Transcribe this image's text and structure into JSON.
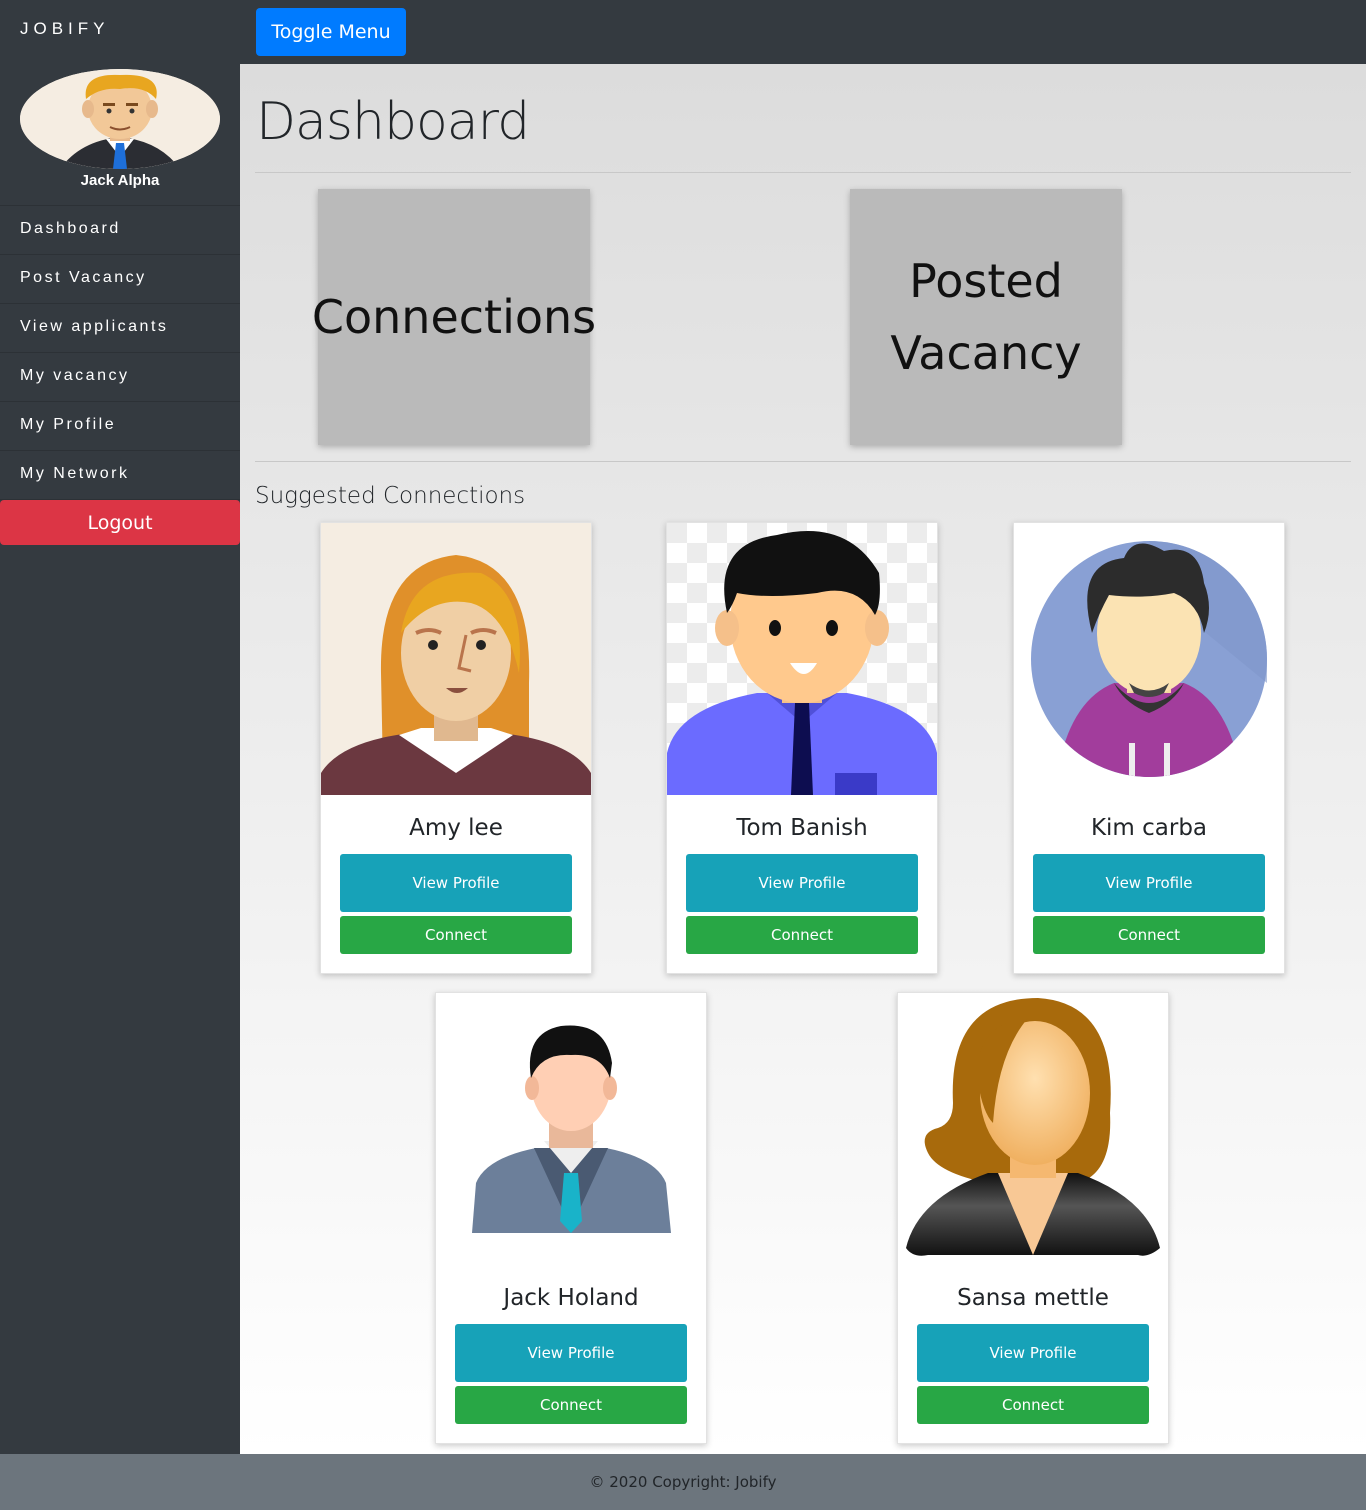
{
  "brand": "JOBIFY",
  "toggle_label": "Toggle Menu",
  "user": {
    "name": "Jack Alpha"
  },
  "nav": [
    "Dashboard",
    "Post Vacancy",
    "View applicants",
    "My vacancy",
    "My Profile",
    "My Network"
  ],
  "logout_label": "Logout",
  "page_title": "Dashboard",
  "stats": {
    "connections": "Connections",
    "posted_line1": "Posted",
    "posted_line2": "Vacancy"
  },
  "section_title": "Suggested Connections",
  "suggestions": [
    {
      "name": "Amy lee",
      "view": "View Profile",
      "connect": "Connect"
    },
    {
      "name": "Tom Banish",
      "view": "View Profile",
      "connect": "Connect"
    },
    {
      "name": "Kim carba",
      "view": "View Profile",
      "connect": "Connect"
    },
    {
      "name": "Jack Holand",
      "view": "View Profile",
      "connect": "Connect"
    },
    {
      "name": "Sansa mettle",
      "view": "View Profile",
      "connect": "Connect"
    }
  ],
  "footer": "© 2020 Copyright: Jobify",
  "colors": {
    "primary": "#007bff",
    "danger": "#dc3545",
    "info": "#17a2b8",
    "success": "#28a745",
    "dark": "#343a40"
  }
}
